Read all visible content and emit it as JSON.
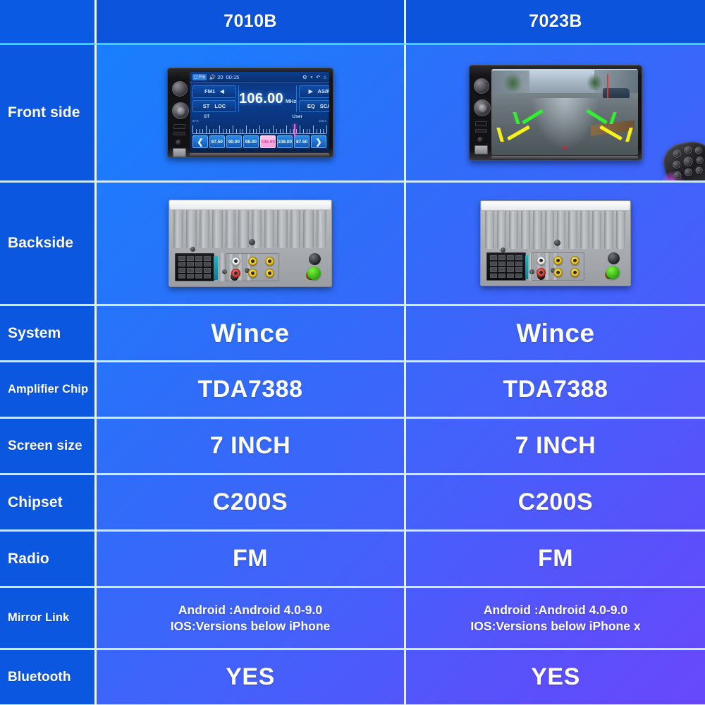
{
  "header": {
    "spacer_label": "",
    "product_a": "7010B",
    "product_b": "7023B"
  },
  "colors": {
    "header_bg": "#0d54dd",
    "label_bg": "#0b57e0",
    "grid_line": "#eaf6ff",
    "gradient_start": "#1383fe",
    "gradient_end": "#6848fb",
    "accent_pink": "#ff5bd0",
    "guide_green": "#2ff22f",
    "guide_yellow": "#f7f019"
  },
  "rows": [
    {
      "label": "Front side",
      "label_size": "lbl-lg",
      "type": "image",
      "a": "7010b-front-radio-screen",
      "b": "7023b-front-rear-camera-view"
    },
    {
      "label": "Backside",
      "label_size": "lbl-lg",
      "type": "image",
      "a": "7010b-backside-connectors",
      "b": "7023b-backside-connectors"
    },
    {
      "label": "System",
      "label_size": "lbl-lg",
      "type": "text",
      "a": "Wince",
      "b": "Wince",
      "size": "v-xl"
    },
    {
      "label": "Amplifier Chip",
      "label_size": "lbl-sm",
      "type": "text",
      "a": "TDA7388",
      "b": "TDA7388",
      "size": "v-lg"
    },
    {
      "label": "Screen size",
      "label_size": "lbl-md",
      "type": "text",
      "a": "7 INCH",
      "b": "7 INCH",
      "size": "v-lg"
    },
    {
      "label": "Chipset",
      "label_size": "lbl-lg",
      "type": "text",
      "a": "C200S",
      "b": "C200S",
      "size": "v-lg"
    },
    {
      "label": "Radio",
      "label_size": "lbl-lg",
      "type": "text",
      "a": "FM",
      "b": "FM",
      "size": "v-lg"
    },
    {
      "label": "Mirror Link",
      "label_size": "lbl-sm",
      "type": "text2",
      "a1": "Android :Android 4.0-9.0",
      "a2": "IOS:Versions below iPhone",
      "b1": "Android :Android 4.0-9.0",
      "b2": "IOS:Versions below iPhone x",
      "size": "v-sm"
    },
    {
      "label": "Bluetooth",
      "label_size": "lbl-md",
      "type": "text",
      "a": "YES",
      "b": "YES",
      "size": "v-lg"
    }
  ],
  "radio_screen": {
    "status": {
      "source_chip": "Fm",
      "volume_icon": "speaker-icon",
      "volume_value": "20",
      "clock": "00:15",
      "settings_icon": "gear-icon",
      "bluetooth_icon": "bluetooth-icon",
      "back_icon": "back-arrow-icon",
      "home_icon": "home-icon"
    },
    "band": "FM1",
    "band_prev_icon": "left-triangle-icon",
    "st_label": "ST",
    "loc_label": "LOC",
    "frequency": "106.00",
    "frequency_unit": "MHz",
    "play_icon": "play-triangle-icon",
    "asps_label": "AS/PS",
    "eq_label": "EQ",
    "scan_label": "SCAN",
    "dial_st_label": "ST",
    "dial_user_label": "User",
    "dial_min": "87.5",
    "dial_max": "108.0",
    "prev_icon": "chevron-left-icon",
    "next_icon": "chevron-right-icon",
    "presets": [
      "87.50",
      "90.00",
      "98.00",
      "106.00",
      "108.00",
      "87.50"
    ],
    "active_preset": "106.00"
  },
  "camera_screen": {
    "guideline_rows": 2,
    "red_marker": "center-distance-marker"
  }
}
